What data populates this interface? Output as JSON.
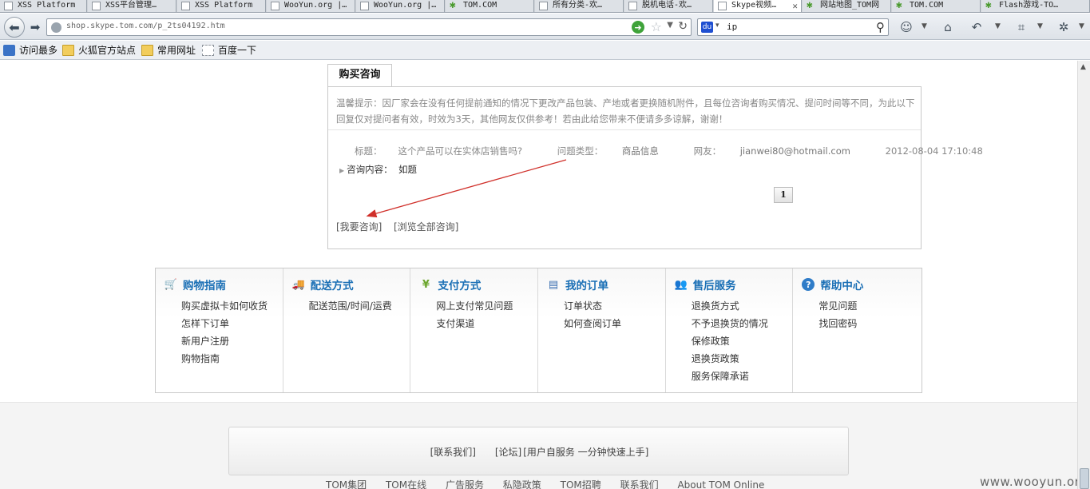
{
  "browser": {
    "tabs": [
      {
        "label": "XSS Platform",
        "icon": "page-icon"
      },
      {
        "label": "XSS平台管理…",
        "icon": "page-icon"
      },
      {
        "label": "XSS Platform",
        "icon": "page-icon"
      },
      {
        "label": "WooYun.org |…",
        "icon": "page-icon"
      },
      {
        "label": "WooYun.org |…",
        "icon": "page-icon"
      },
      {
        "label": "TOM.COM",
        "icon": "tom-icon"
      },
      {
        "label": "所有分类-欢…",
        "icon": "page-icon"
      },
      {
        "label": "脱机电话-欢…",
        "icon": "page-icon"
      },
      {
        "label": "Skype视频…",
        "icon": "page-icon",
        "active": true
      },
      {
        "label": "网站地图_TOM网",
        "icon": "tom-icon"
      },
      {
        "label": "TOM.COM",
        "icon": "tom-icon"
      },
      {
        "label": "Flash游戏-TO…",
        "icon": "tom-icon"
      }
    ],
    "url": "shop.skype.tom.com/p_2ts04192.htm",
    "search_value": "ip",
    "bookmarks": [
      "访问最多",
      "火狐官方站点",
      "常用网址",
      "百度一下"
    ]
  },
  "consult": {
    "tab_label": "购买咨询",
    "notice": "温馨提示：因厂家会在没有任何提前通知的情况下更改产品包装、产地或者更换随机附件，且每位咨询者购买情况、提问时间等不同，为此以下回复仅对提问者有效，时效为3天，其他网友仅供参考！若由此给您带来不便请多多谅解，谢谢！",
    "question": {
      "title_label": "标题：",
      "title": "这个产品可以在实体店销售吗?",
      "type_label": "问题类型：",
      "type": "商品信息",
      "user_label": "网友：",
      "user": "jianwei80@hotmail.com",
      "time": "2012-08-04 17:10:48",
      "content_label": "咨询内容：",
      "content": "如题"
    },
    "page_number": "1",
    "my_consult": "[我要咨询]",
    "all_consult": "[浏览全部咨询]"
  },
  "help": [
    {
      "title": "购物指南",
      "icon": "cart-icon",
      "items": [
        "购买虚拟卡如何收货",
        "怎样下订单",
        "新用户注册",
        "购物指南"
      ]
    },
    {
      "title": "配送方式",
      "icon": "truck-icon",
      "items": [
        "配送范围/时间/运费"
      ]
    },
    {
      "title": "支付方式",
      "icon": "yen-icon",
      "items": [
        "网上支付常见问题",
        "支付渠道"
      ]
    },
    {
      "title": "我的订单",
      "icon": "order-icon",
      "items": [
        "订单状态",
        "如何查阅订单"
      ]
    },
    {
      "title": "售后服务",
      "icon": "service-icon",
      "items": [
        "退换货方式",
        "不予退换货的情况",
        "保修政策",
        "退换货政策",
        "服务保障承诺"
      ]
    },
    {
      "title": "帮助中心",
      "icon": "help-icon",
      "items": [
        "常见问题",
        "找回密码"
      ]
    }
  ],
  "footer": {
    "contact": "[联系我们]",
    "forum": "[论坛]",
    "self_service": "[用户自服务 一分钟快速上手]",
    "bottom_links": [
      "TOM集团",
      "TOM在线",
      "广告服务",
      "私隐政策",
      "TOM招聘",
      "联系我们",
      "About TOM Online"
    ]
  },
  "watermark": "www.wooyun.org",
  "colors": {
    "help_title": "#1a6fb5",
    "arrow": "#d0302a"
  }
}
